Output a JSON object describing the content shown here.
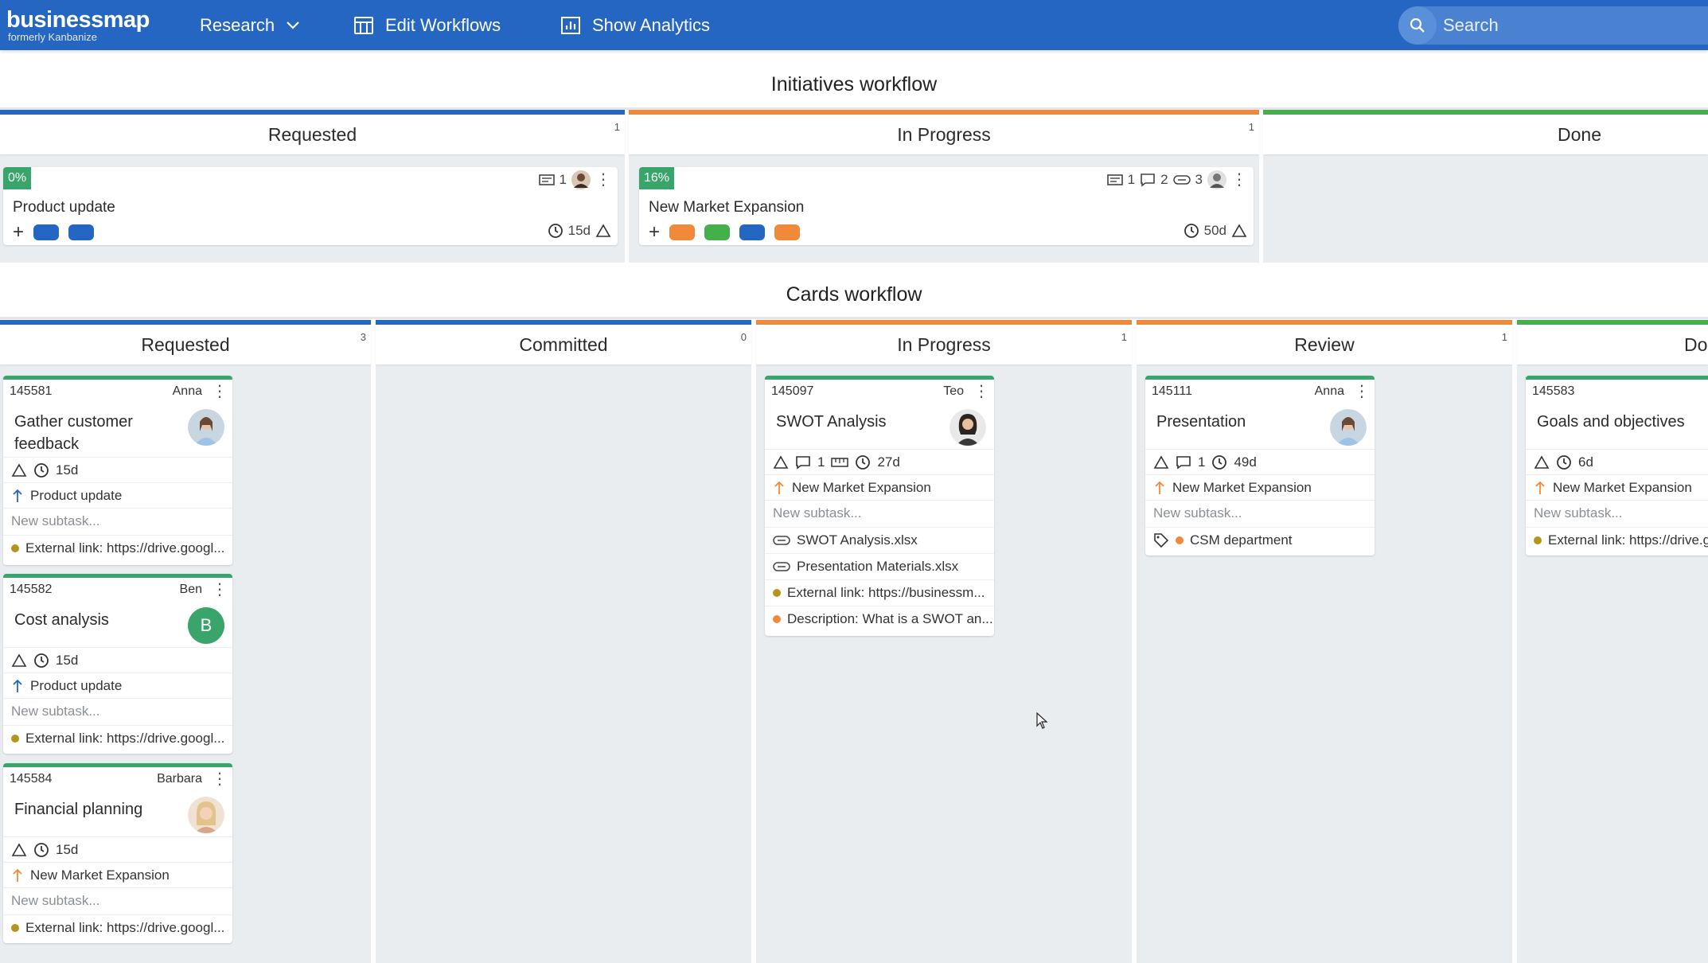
{
  "topbar": {
    "logo": "businessmap",
    "logo_sub": "formerly Kanbanize",
    "nav": {
      "research": "Research",
      "edit_workflows": "Edit Workflows",
      "show_analytics": "Show Analytics"
    },
    "search_placeholder": "Search"
  },
  "initiatives": {
    "title": "Initiatives workflow",
    "columns": [
      {
        "name": "Requested",
        "count": "1",
        "color": "#2566c2"
      },
      {
        "name": "In Progress",
        "count": "1",
        "color": "#f08a3a"
      },
      {
        "name": "Done",
        "count": "",
        "color": "#45b04b"
      }
    ],
    "cards": [
      {
        "pct": "0%",
        "title": "Product update",
        "cards_count": "1",
        "due": "15d"
      },
      {
        "pct": "16%",
        "title": "New Market Expansion",
        "cards_count": "1",
        "comments": "2",
        "attachments": "3",
        "due": "50d"
      }
    ]
  },
  "cards_wf": {
    "title": "Cards workflow",
    "columns": [
      {
        "name": "Requested",
        "count": "3",
        "color": "#2566c2"
      },
      {
        "name": "Committed",
        "count": "0",
        "color": "#2566c2"
      },
      {
        "name": "In Progress",
        "count": "1",
        "color": "#f08a3a"
      },
      {
        "name": "Review",
        "count": "1",
        "color": "#f08a3a"
      },
      {
        "name": "Do",
        "count": "",
        "color": "#45b04b"
      }
    ],
    "cards": [
      {
        "id": "145581",
        "owner": "Anna",
        "title": "Gather customer feedback",
        "due": "15d",
        "parent": "Product update",
        "subtask": "New subtask...",
        "link": "External link: https://drive.googl..."
      },
      {
        "id": "145582",
        "owner": "Ben",
        "title": "Cost analysis",
        "avatar_letter": "B",
        "due": "15d",
        "parent": "Product update",
        "subtask": "New subtask...",
        "link": "External link: https://drive.googl..."
      },
      {
        "id": "145584",
        "owner": "Barbara",
        "title": "Financial planning",
        "due": "15d",
        "parent": "New Market Expansion",
        "subtask": "New subtask...",
        "link": "External link: https://drive.googl..."
      },
      {
        "id": "145097",
        "owner": "Teo",
        "title": "SWOT Analysis",
        "comments": "1",
        "due": "27d",
        "parent": "New Market Expansion",
        "subtask": "New subtask...",
        "file1": "SWOT Analysis.xlsx",
        "file2": "Presentation Materials.xlsx",
        "link": "External link: https://businessm...",
        "desc": "Description: What is a SWOT an..."
      },
      {
        "id": "145111",
        "owner": "Anna",
        "title": "Presentation",
        "comments": "1",
        "due": "49d",
        "parent": "New Market Expansion",
        "subtask": "New subtask...",
        "tag": "CSM department"
      },
      {
        "id": "145583",
        "owner": "",
        "title": "Goals and objectives",
        "due": "6d",
        "parent": "New Market Expansion",
        "subtask": "New subtask...",
        "link": "External link: https://drive.g"
      }
    ]
  },
  "colors": {
    "brand": "#2566c2",
    "green": "#3aa56b",
    "orange": "#f08a3a",
    "blue_tag": "#2566c2",
    "green_tag": "#45b04b",
    "olive_dot": "#b5941c"
  }
}
